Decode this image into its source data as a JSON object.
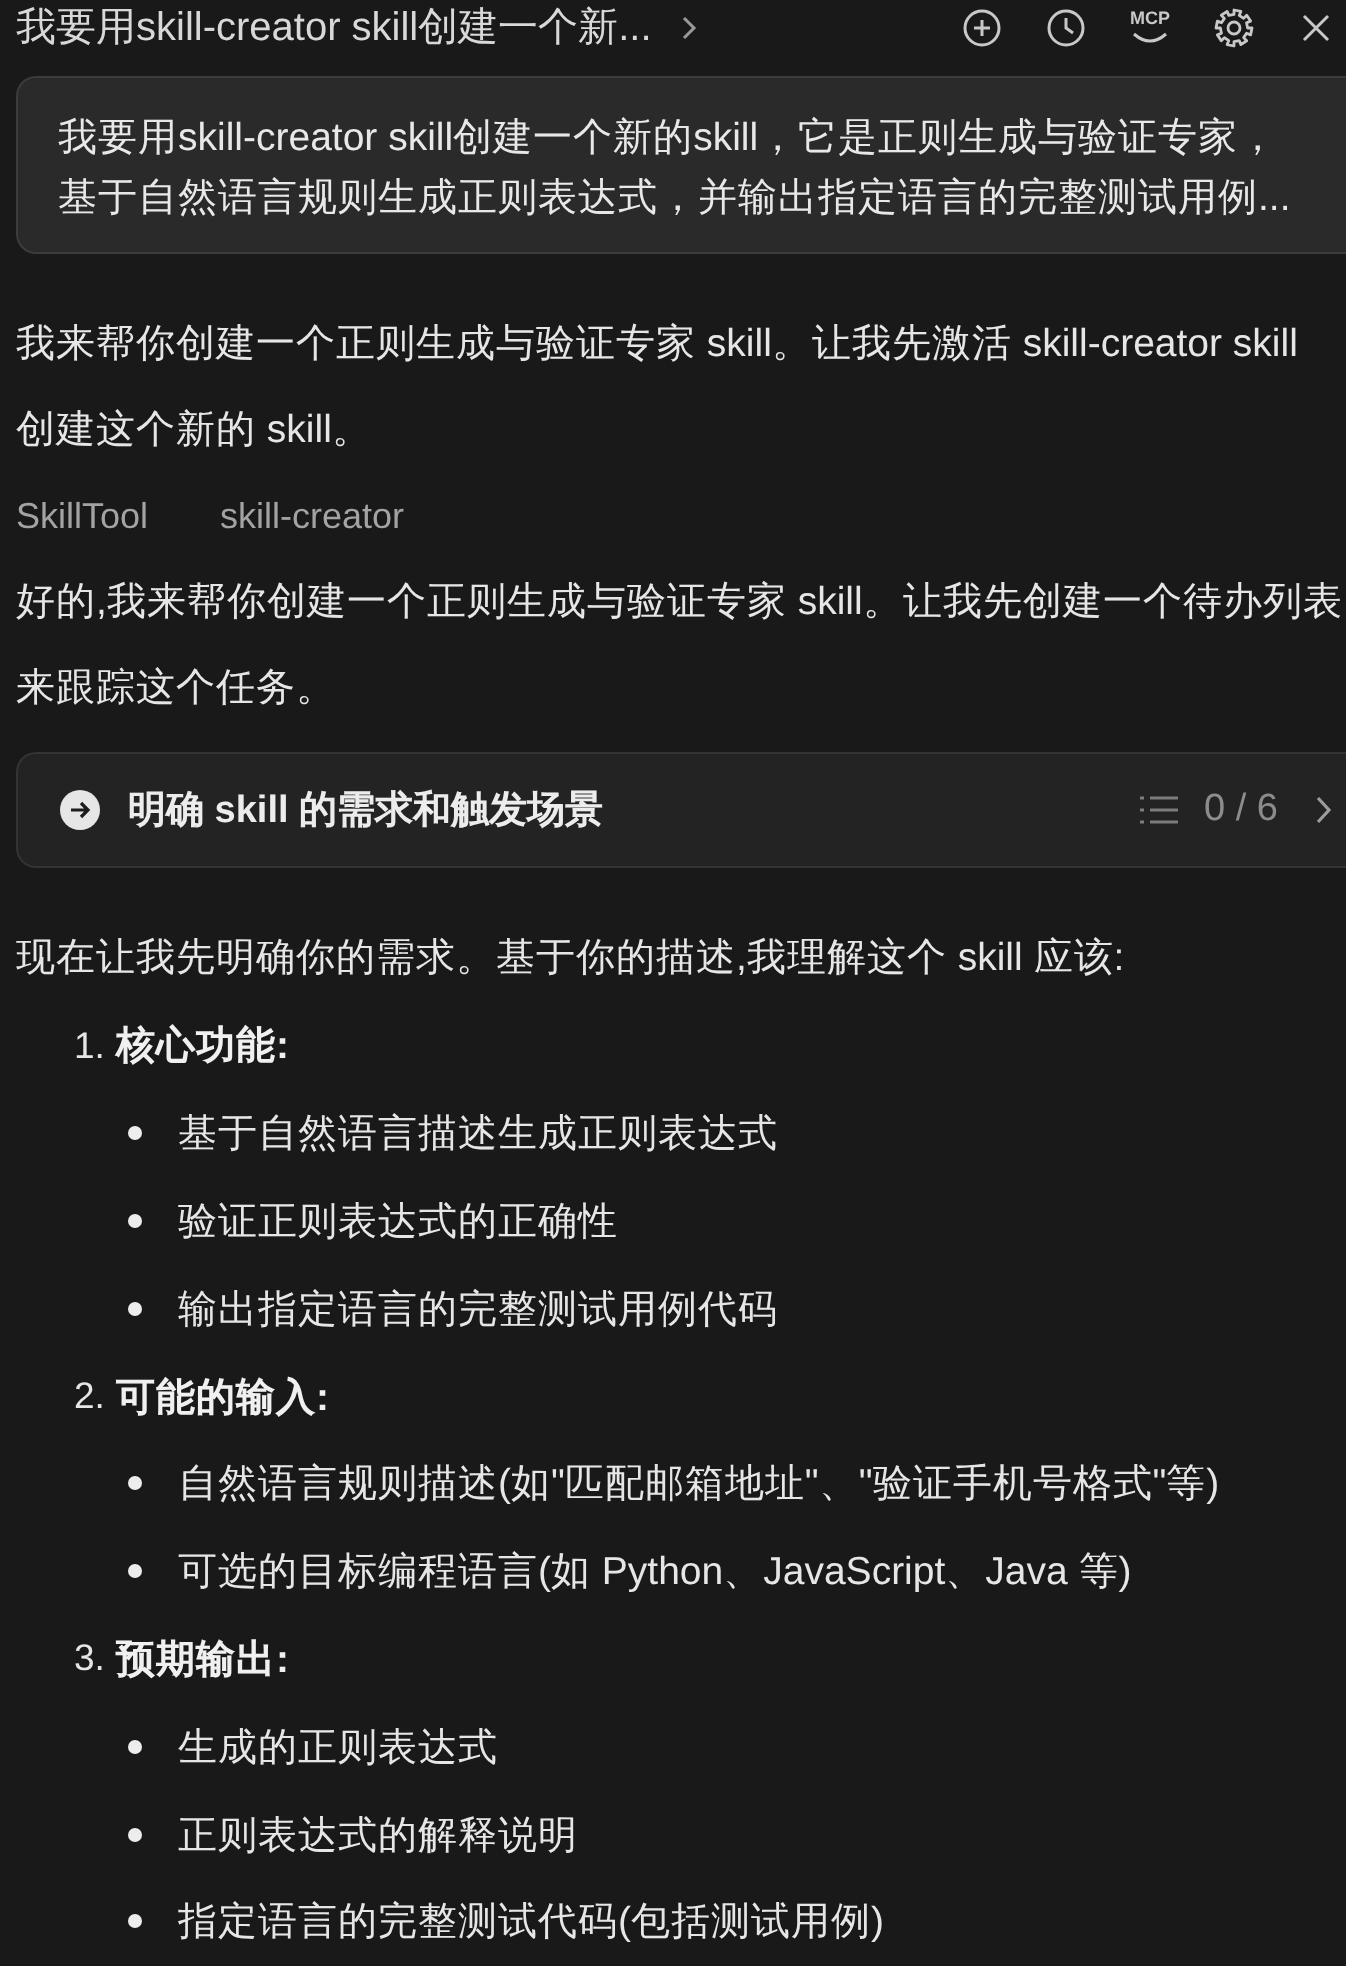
{
  "header": {
    "title": "我要用skill-creator skill创建一个新...",
    "actions": [
      {
        "kind": "new-chat"
      },
      {
        "kind": "history"
      },
      {
        "kind": "mcp",
        "label": "MCP"
      },
      {
        "kind": "settings"
      },
      {
        "kind": "close"
      }
    ]
  },
  "conversation": [
    {
      "kind": "user",
      "lines": [
        "我要用skill-creator skill创建一个新的skill，它是正则生成与验证专家，",
        "基于自然语言规则生成正则表达式，并输出指定语言的完整测试用例..."
      ]
    },
    {
      "kind": "text",
      "lines": [
        "我来帮你创建一个正则生成与验证专家 skill。让我先激活 skill-creator skill",
        "创建这个新的 skill。"
      ]
    },
    {
      "kind": "tool",
      "tool": "SkillTool",
      "argument": "skill-creator"
    },
    {
      "kind": "text",
      "lines": [
        "好的,我来帮你创建一个正则生成与验证专家 skill。让我先创建一个待办列表",
        "来跟踪这个任务。"
      ]
    },
    {
      "kind": "todo",
      "task": "明确 skill 的需求和触发场景",
      "count": "0 / 6"
    },
    {
      "kind": "text",
      "lines": [
        "现在让我先明确你的需求。基于你的描述,我理解这个 skill 应该:"
      ]
    },
    {
      "kind": "list",
      "items": [
        {
          "number": "1.",
          "heading": "核心功能:",
          "children": [
            {
              "text": "基于自然语言描述生成正则表达式"
            },
            {
              "text": "验证正则表达式的正确性"
            },
            {
              "text": "输出指定语言的完整测试用例代码"
            }
          ]
        },
        {
          "number": "2.",
          "heading": "可能的输入:",
          "children": [
            {
              "text": "自然语言规则描述(如\"匹配邮箱地址\"、\"验证手机号格式\"等)"
            },
            {
              "text": "可选的目标编程语言(如 Python、JavaScript、Java 等)"
            }
          ]
        },
        {
          "number": "3.",
          "heading": "预期输出:",
          "children": [
            {
              "text": "生成的正则表达式"
            },
            {
              "text": "正则表达式的解释说明"
            },
            {
              "text": "指定语言的完整测试代码(包括测试用例)"
            }
          ]
        }
      ]
    }
  ]
}
